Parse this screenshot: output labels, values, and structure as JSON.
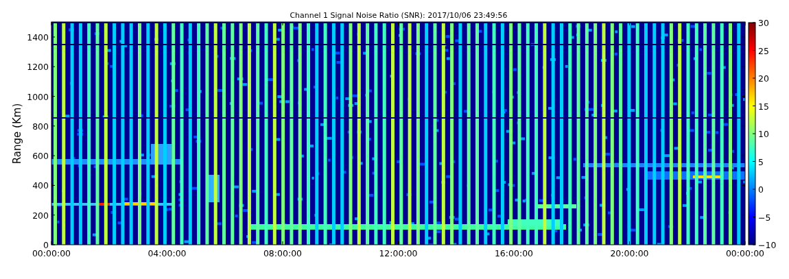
{
  "chart": {
    "title": "Channel 1 Signal Noise Ratio (SNR): 2017/10/06 23:49:56",
    "ylabel": "Range (Km)",
    "y_tick_labels": [
      "1400",
      "1200",
      "1000",
      "800",
      "600",
      "400",
      "200",
      "0"
    ],
    "x_tick_labels": [
      "00:00:00",
      "04:00:00",
      "08:00:00",
      "12:00:00",
      "16:00:00",
      "20:00:00",
      "00:00:00"
    ],
    "colorbar_tick_labels": [
      "30",
      "25",
      "20",
      "15",
      "10",
      "5",
      "0",
      "−5",
      "−10"
    ]
  }
}
